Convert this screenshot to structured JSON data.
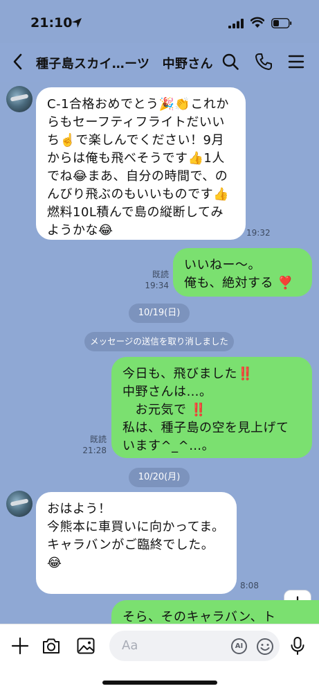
{
  "status_bar": {
    "time": "21:10"
  },
  "header": {
    "title": "種子島スカイ…ーツ　中野さん"
  },
  "messages": [
    {
      "text": "C-1合格おめでとう🎉👏これからもセーフティフライトだいいち☝️で楽しんでください！9月からは俺も飛べそうです👍1人でね😂まあ、自分の時間で、のんびり飛ぶのもいいものです👍燃料10L積んで島の縦断してみようかな😂",
      "time": "19:32"
    },
    {
      "text": "いいねー〜。\n俺も、絶対する ❣️",
      "read": "既読",
      "time": "19:34"
    },
    {
      "date": "10/19(日)"
    },
    {
      "notice": "メッセージの送信を取り消しました"
    },
    {
      "text": "今日も、飛びました‼️\n中野さんは…。\n　お元気で ‼️\n私は、種子島の空を見上げています^_^…。",
      "read": "既読",
      "time": "21:28"
    },
    {
      "date": "10/20(月)"
    },
    {
      "text": "おはよう！\n今熊本に車買いに向かってま。\nキャラバンがご臨終でした。\n😂",
      "time": "8:08"
    },
    {
      "text": "そら、そのキャラバン、ト"
    }
  ],
  "input": {
    "placeholder": "Aa",
    "ai_label": "AI"
  },
  "colors": {
    "background": "#8fa8d4",
    "bubble_out": "#7be070",
    "bubble_in": "#ffffff"
  }
}
